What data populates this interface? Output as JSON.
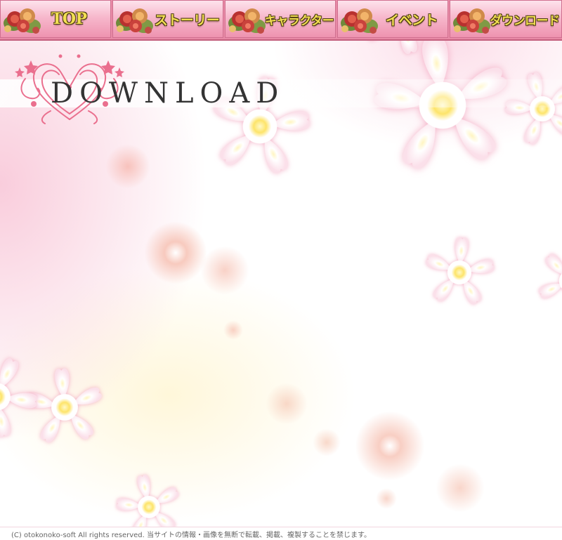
{
  "nav": {
    "items": [
      {
        "label": "TOP"
      },
      {
        "label": "ストーリー"
      },
      {
        "label": "キャラクター"
      },
      {
        "label": "イベント"
      },
      {
        "label": "ダウンロード"
      }
    ]
  },
  "page": {
    "title": "DOWNLOAD"
  },
  "footer": {
    "copyright": "(C) otokonoko-soft All rights reserved. 当サイトの情報・画像を無断で転載、掲載、複製することを禁じます。"
  },
  "colors": {
    "nav_gradient_top": "#fde3ec",
    "nav_gradient_bottom": "#ee93b0",
    "nav_label": "#f2df52",
    "ornament": "#ea6f8e",
    "background_pink": "#f8c4d6",
    "blossom_center": "#fde46a"
  },
  "icons": {
    "nav_decoration": "rose-bouquet-icon",
    "title_decoration": "heart-flourish-icon",
    "background": "cherry-blossom"
  }
}
